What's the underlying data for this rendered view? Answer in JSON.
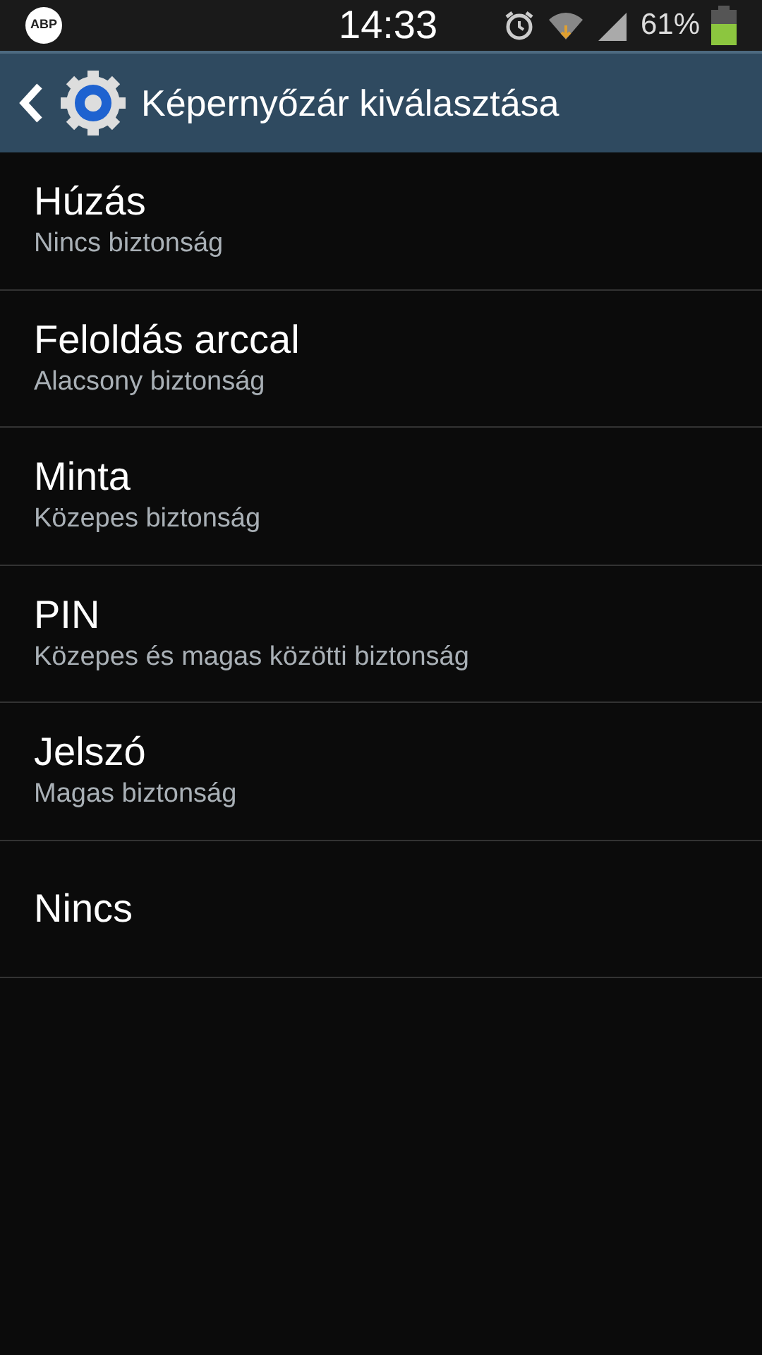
{
  "status_bar": {
    "app_badge": "ABP",
    "time": "14:33",
    "battery_text": "61%"
  },
  "header": {
    "title": "Képernyőzár kiválasztása"
  },
  "options": [
    {
      "title": "Húzás",
      "subtitle": "Nincs biztonság"
    },
    {
      "title": "Feloldás arccal",
      "subtitle": "Alacsony biztonság"
    },
    {
      "title": "Minta",
      "subtitle": "Közepes biztonság"
    },
    {
      "title": "PIN",
      "subtitle": "Közepes és magas közötti biztonság"
    },
    {
      "title": "Jelszó",
      "subtitle": "Magas biztonság"
    },
    {
      "title": "Nincs"
    }
  ]
}
